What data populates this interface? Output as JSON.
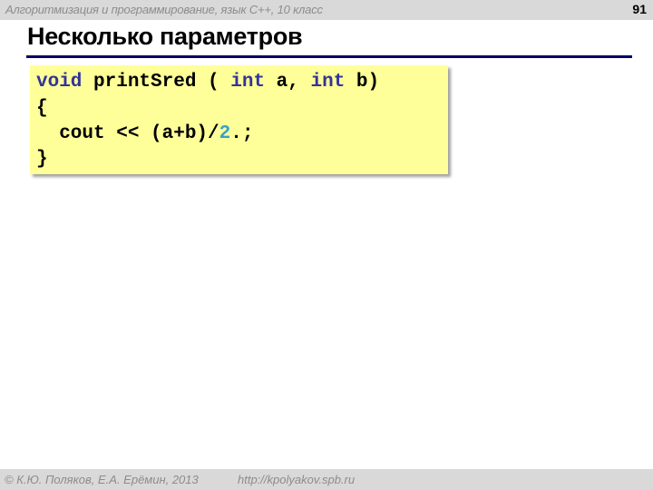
{
  "header": {
    "course_title": "Алгоритмизация и программирование, язык  C++, 10 класс",
    "slide_number": "91"
  },
  "slide": {
    "title": "Несколько параметров"
  },
  "code": {
    "lines": [
      [
        {
          "text": "void",
          "kind": "keyword"
        },
        {
          "text": " printSred ( ",
          "kind": "plain"
        },
        {
          "text": "int",
          "kind": "keyword"
        },
        {
          "text": " a, ",
          "kind": "plain"
        },
        {
          "text": "int",
          "kind": "keyword"
        },
        {
          "text": " b)",
          "kind": "plain"
        }
      ],
      [
        {
          "text": "{",
          "kind": "plain"
        }
      ],
      [
        {
          "text": "  cout << (a+b)/",
          "kind": "plain"
        },
        {
          "text": "2",
          "kind": "number"
        },
        {
          "text": ".;",
          "kind": "plain"
        }
      ],
      [
        {
          "text": "}",
          "kind": "plain"
        }
      ]
    ],
    "colors": {
      "keyword": "#333399",
      "number": "#33a3cc",
      "plain": "#000000",
      "background": "#ffff99"
    }
  },
  "footer": {
    "copyright": "© К.Ю. Поляков, Е.А. Ерёмин, 2013",
    "url": "http://kpolyakov.spb.ru"
  }
}
